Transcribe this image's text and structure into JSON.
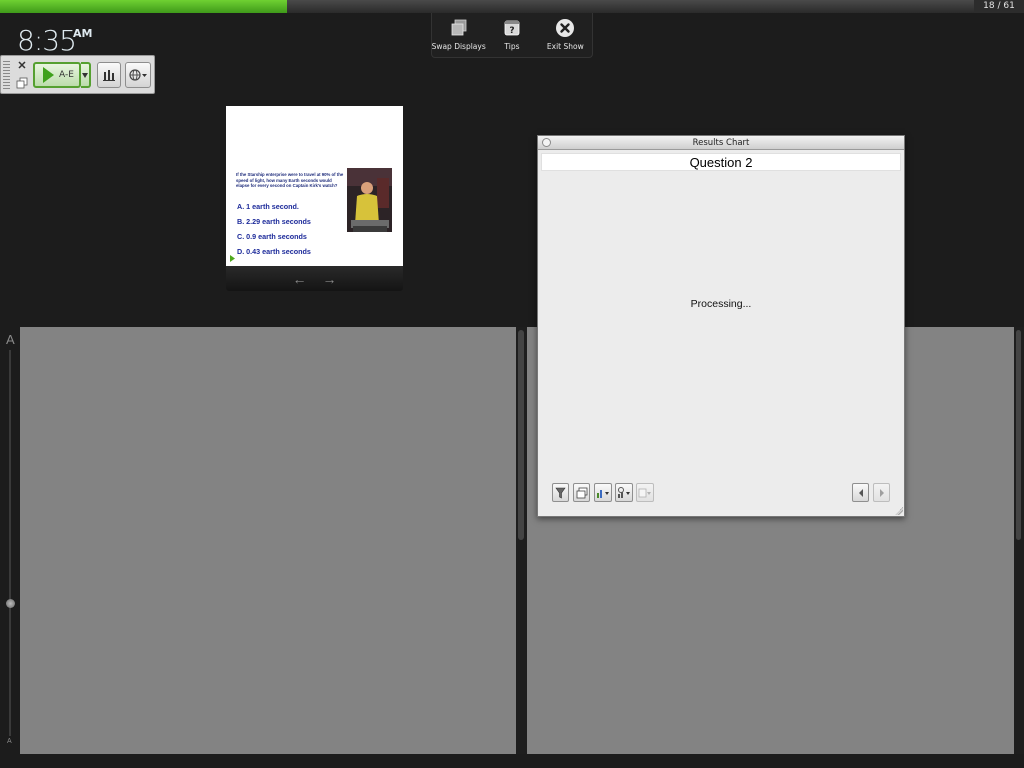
{
  "progress": {
    "fraction": 0.295,
    "counter": "18 / 61",
    "fill_color": "#52b51f"
  },
  "clock": {
    "time": "8:35",
    "ampm": "AM"
  },
  "top_controls": {
    "swap_label": "Swap Displays",
    "tips_label": "Tips",
    "tips_icon_text": "?",
    "exit_label": "Exit Show"
  },
  "poll_toolbar": {
    "close_glyph": "✕",
    "start_label": "A-E"
  },
  "slide": {
    "question": "If the Starship enterprise were to travel at 90% of the speed of light, how many Earth seconds would elapse for every second on Captain Kirk's watch?",
    "answers": [
      "A. 1 earth second.",
      "B. 2.29 earth seconds",
      "C. 0.9 earth seconds",
      "D. 0.43 earth seconds"
    ],
    "prev_glyph": "←",
    "next_glyph": "→"
  },
  "font_slider": {
    "large": "A",
    "small": "A"
  },
  "results_window": {
    "title": "Results Chart",
    "question": "Question 2",
    "status": "Processing..."
  }
}
